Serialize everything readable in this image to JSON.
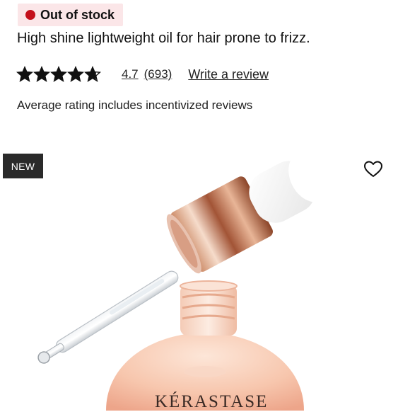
{
  "stock": {
    "status_text": "Out of stock",
    "status_color": "#c4101b",
    "badge_bg": "#fbe6e8"
  },
  "product": {
    "subtitle": "High shine lightweight oil for hair prone to frizz.",
    "brand_label": "KÉRASTASE",
    "image_alt": "product-photo-serum-dropper-bottle"
  },
  "rating": {
    "stars_value": 4.7,
    "stars_max": 5,
    "value_text": "4.7",
    "count_text": "(693)",
    "write_review_label": "Write a review",
    "star_icon": "star-icon",
    "star_color": "#111111"
  },
  "disclaimer": "Average rating includes incentivized reviews",
  "badge": {
    "new_label": "NEW"
  },
  "wishlist": {
    "icon": "heart-outline-icon"
  }
}
